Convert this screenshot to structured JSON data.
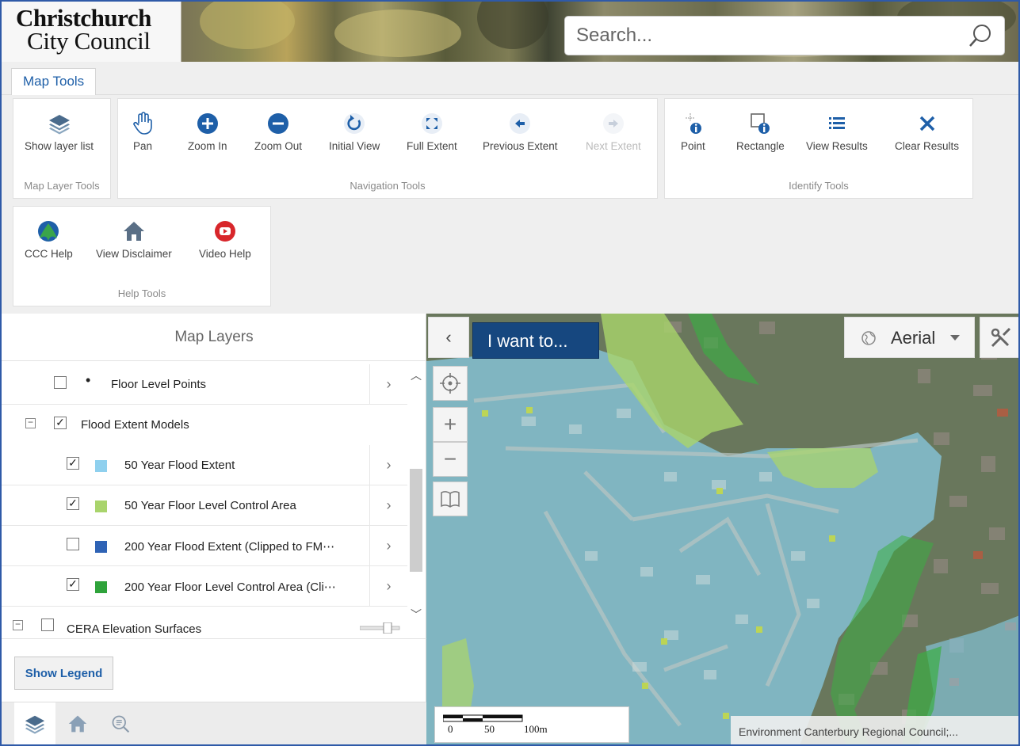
{
  "header": {
    "logo_line1": "Christchurch",
    "logo_line2": "City Council",
    "search_placeholder": "Search..."
  },
  "tabs": [
    {
      "label": "Map Tools"
    }
  ],
  "toolbar": {
    "map_layer_tools": {
      "title": "Map Layer Tools",
      "items": [
        {
          "label": "Show layer list",
          "icon": "layers-icon"
        }
      ]
    },
    "navigation_tools": {
      "title": "Navigation Tools",
      "items": [
        {
          "label": "Pan",
          "icon": "hand-icon"
        },
        {
          "label": "Zoom In",
          "icon": "plus-circle-icon"
        },
        {
          "label": "Zoom Out",
          "icon": "minus-circle-icon"
        },
        {
          "label": "Initial View",
          "icon": "refresh-icon"
        },
        {
          "label": "Full Extent",
          "icon": "expand-icon"
        },
        {
          "label": "Previous Extent",
          "icon": "arrow-left-icon"
        },
        {
          "label": "Next Extent",
          "icon": "arrow-right-icon",
          "disabled": true
        }
      ]
    },
    "identify_tools": {
      "title": "Identify Tools",
      "items": [
        {
          "label": "Point",
          "icon": "point-info-icon"
        },
        {
          "label": "Rectangle",
          "icon": "rectangle-info-icon"
        },
        {
          "label": "View Results",
          "icon": "list-icon"
        },
        {
          "label": "Clear Results",
          "icon": "close-icon"
        }
      ]
    },
    "help_tools": {
      "title": "Help Tools",
      "items": [
        {
          "label": "CCC Help",
          "icon": "ccc-help-icon"
        },
        {
          "label": "View Disclaimer",
          "icon": "home-icon"
        },
        {
          "label": "Video Help",
          "icon": "youtube-icon"
        }
      ]
    }
  },
  "map_layers": {
    "title": "Map Layers",
    "rows": [
      {
        "label": "Floor Level Points",
        "checked": false,
        "symbol": "dot"
      },
      {
        "label": "Flood Extent Models",
        "checked": true,
        "group": true
      },
      {
        "label": "50 Year Flood Extent",
        "checked": true,
        "color": "#8fd0ee"
      },
      {
        "label": "50 Year Floor Level Control Area",
        "checked": true,
        "color": "#a9d46c"
      },
      {
        "label": "200 Year Flood Extent (Clipped to FM⋯",
        "checked": false,
        "color": "#2f63b5"
      },
      {
        "label": "200 Year Floor Level Control Area (Cli⋯",
        "checked": true,
        "color": "#2fa33b"
      },
      {
        "label": "CERA Elevation Surfaces",
        "checked": false,
        "group": true
      }
    ],
    "show_legend_label": "Show Legend"
  },
  "map": {
    "iwant_label": "I want to...",
    "basemap_label": "Aerial",
    "scale_labels": [
      "0",
      "50",
      "100m"
    ],
    "attribution": "Environment Canterbury Regional Council;..."
  },
  "colors": {
    "accent": "#1e5fa8",
    "iwant_bg": "#16477f",
    "flood_50": "#8fd0ee",
    "floor_50": "#a9d46c",
    "floor_200": "#2fa33b"
  }
}
